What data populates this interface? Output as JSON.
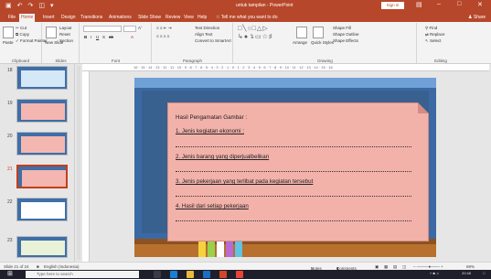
{
  "window": {
    "doc_title": "untuk tampilan - PowerPoint",
    "signin_label": "Sign in",
    "colors": {
      "accent": "#b7472a",
      "slide_bg": "#3a69a4",
      "card": "#f2b2aa"
    }
  },
  "tabs": [
    "File",
    "Home",
    "Insert",
    "Design",
    "Transitions",
    "Animations",
    "Slide Show",
    "Review",
    "View",
    "Help",
    "Tell me what you want to do"
  ],
  "share_label": "Share",
  "ribbon": {
    "clipboard": {
      "paste": "Paste",
      "cut": "Cut",
      "copy": "Copy",
      "format_painter": "Format Painter",
      "label": "Clipboard"
    },
    "slides": {
      "new_slide": "New Slide",
      "layout": "Layout",
      "reset": "Reset",
      "section": "Section",
      "label": "Slides"
    },
    "font": {
      "label": "Font"
    },
    "paragraph": {
      "text_direction": "Text Direction",
      "align_text": "Align Text",
      "smartart": "Convert to SmartArt",
      "label": "Paragraph"
    },
    "drawing": {
      "arrange": "Arrange",
      "quick_styles": "Quick Styles",
      "shape_fill": "Shape Fill",
      "shape_outline": "Shape Outline",
      "shape_effects": "Shape Effects",
      "label": "Drawing"
    },
    "editing": {
      "find": "Find",
      "replace": "Replace",
      "select": "Select",
      "label": "Editing"
    }
  },
  "thumbnails": [
    "18",
    "19",
    "20",
    "21",
    "22",
    "23"
  ],
  "selected_slide": "21",
  "ruler_text": "16 · 15 · 14 · 13 · 12 · 11 · 10 · 9 · 8 · 7 · 6 · 5 · 4 · 3 · 2 · 1 · 0 · 1 · 2 · 3 · 4 · 5 · 6 · 7 · 8 · 9 · 10 · 11 · 12 · 13 · 14 · 15 · 16",
  "slide": {
    "heading": "Hasil Pengamatan Gambar :",
    "items": [
      "1. Jenis kegiatan ekonomi :",
      "2. Jenis barang yang diperjualbelikan",
      "3. Jenis pekerjaan yang terlibat pada kegiatan tersebut",
      "4. Hasil dari setiap pekerjaan"
    ]
  },
  "status": {
    "slide_info": "Slide 21 of 24",
    "language": "English (Indonesia)",
    "notes": "Notes",
    "comments": "Comments",
    "zoom": "69%"
  },
  "taskbar": {
    "search_placeholder": "Type here to search",
    "time": "20:48"
  }
}
